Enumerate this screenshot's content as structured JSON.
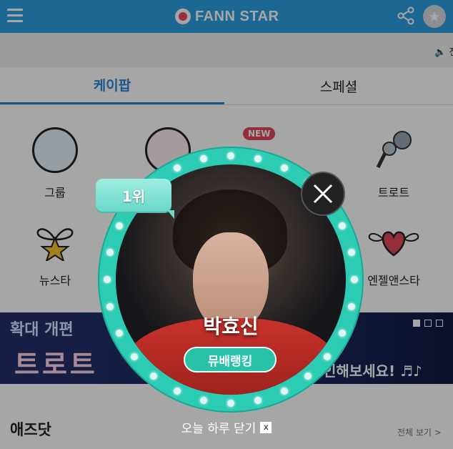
{
  "header": {
    "logo_text": "FANN STAR",
    "brand_color": "#2ba0e0"
  },
  "notice": {
    "text": "전"
  },
  "tabs": [
    {
      "label": "케이팝",
      "active": true
    },
    {
      "label": "스페셜",
      "active": false
    }
  ],
  "categories": [
    {
      "label": "그룹",
      "icon": "group-icon"
    },
    {
      "label": "트로트",
      "icon": "microphone-icon"
    },
    {
      "label": "뉴스타",
      "icon": "sprout-star-icon"
    },
    {
      "label": "엔젤앤스타",
      "icon": "winged-heart-icon"
    }
  ],
  "new_badge": "NEW",
  "banner": {
    "left_line1": "확대 개편",
    "left_line2": "트로트",
    "right_text": "인해보세요! ♬♪"
  },
  "section": {
    "title": "애즈닷",
    "see_all": "전체 보기 >"
  },
  "popup": {
    "rank_badge": "1위",
    "name": "박효신",
    "ranking_button": "뮤배랭킹",
    "dismiss_text": "오늘 하루 닫기",
    "dismiss_x": "x",
    "ring_color": "#2bcbb4"
  }
}
